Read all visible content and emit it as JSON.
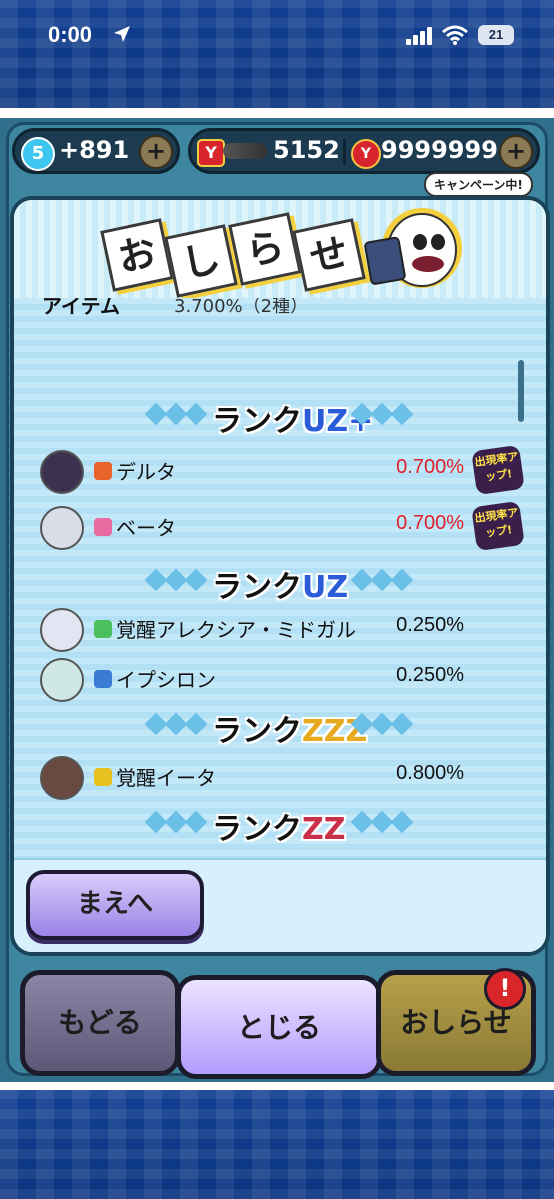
{
  "status_bar": {
    "time": "0:00",
    "battery": "21"
  },
  "currency": {
    "level": "5",
    "stamina": "+891",
    "money": "5152",
    "points": "9999999",
    "plus": "+",
    "campaign": "キャンペーン中!"
  },
  "notice": {
    "title_chars": [
      "お",
      "し",
      "ら",
      "せ"
    ],
    "partial_item_label": "アイテム",
    "partial_item_rate": "3.700%（2種）",
    "ranks": [
      {
        "label": "ランク",
        "grade": "UZ+",
        "grade_class": "",
        "entries": [
          {
            "name": "デルタ",
            "rate": "0.700%",
            "highlight": true,
            "badge": "出現率アップ!",
            "attr_color": "#e8622a",
            "avatar_color": "#3d3150"
          },
          {
            "name": "ベータ",
            "rate": "0.700%",
            "highlight": true,
            "badge": "出現率アップ!",
            "attr_color": "#e86aa0",
            "avatar_color": "#d8dde8"
          }
        ]
      },
      {
        "label": "ランク",
        "grade": "UZ",
        "grade_class": "",
        "entries": [
          {
            "name": "覚醒アレクシア・ミドガル",
            "rate": "0.250%",
            "highlight": false,
            "badge": "",
            "attr_color": "#4bbf5c",
            "avatar_color": "#e3e6f2"
          },
          {
            "name": "イプシロン",
            "rate": "0.250%",
            "highlight": false,
            "badge": "",
            "attr_color": "#3a7bd5",
            "avatar_color": "#cfe8e6"
          }
        ]
      },
      {
        "label": "ランク",
        "grade": "ZZZ",
        "grade_class": "zzz",
        "entries": [
          {
            "name": "覚醒イータ",
            "rate": "0.800%",
            "highlight": false,
            "badge": "",
            "attr_color": "#e7c21e",
            "avatar_color": "#6a4a40"
          }
        ]
      },
      {
        "label": "ランク",
        "grade": "ZZ",
        "grade_class": "zz",
        "entries": []
      }
    ],
    "prev_button": "まえへ"
  },
  "bottom_nav": {
    "back": "もどる",
    "close": "とじる",
    "notice": "おしらせ",
    "alert": "!"
  },
  "colors": {
    "highlight_rate": "#e0202a",
    "grade_uz": "#2a5bd8",
    "grade_zzz": "#e7a91e",
    "grade_zz": "#c9314b"
  }
}
